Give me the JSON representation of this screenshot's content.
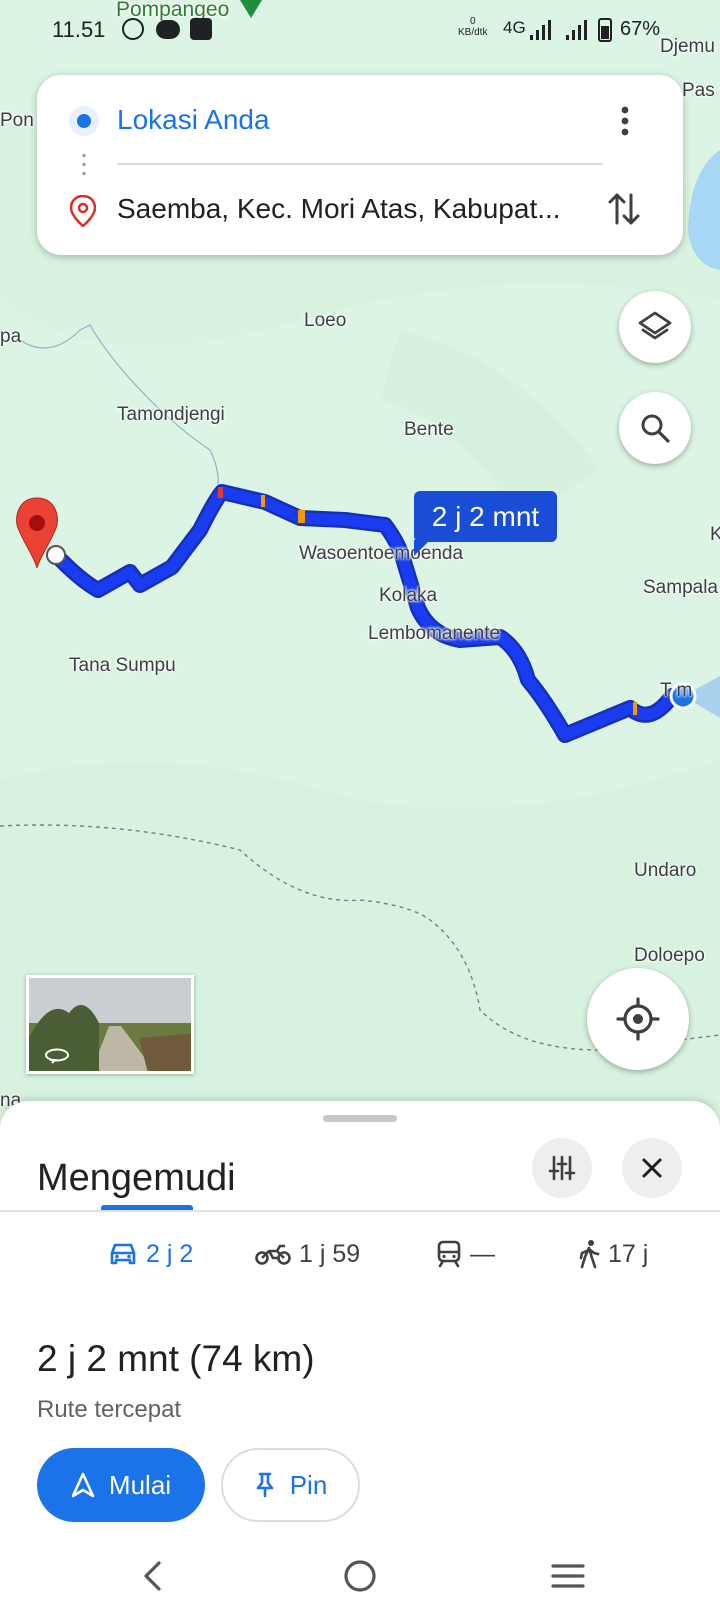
{
  "status_bar": {
    "time": "11.51",
    "notification_icons": [
      "whatsapp-icon",
      "line-icon",
      "app-icon"
    ],
    "speed_value": "0",
    "speed_unit": "KB/dtk",
    "network": "4G",
    "battery": "67%"
  },
  "search": {
    "origin": "Lokasi Anda",
    "destination": "Saemba, Kec. Mori Atas, Kabupat..."
  },
  "map": {
    "places": {
      "pompangeo": "Pompangeo",
      "djemu": "Djemu",
      "pas": "Pas",
      "pon": "Pon",
      "loeo": "Loeo",
      "pa": "pa",
      "tamondjengi": "Tamondjengi",
      "bente": "Bente",
      "k": "K",
      "wasoentoemoenda": "Wasoentoemoenda",
      "sampala": "Sampala",
      "kolaka": "Kolaka",
      "lembomanente": "Lembomanente",
      "tana_sumpu": "Tana Sumpu",
      "tomata": "T    m",
      "undaro": "Undaro",
      "doloepo": "Doloepo",
      "na": "na"
    },
    "route_callout": "2 j 2 mnt"
  },
  "sheet": {
    "title": "Mengemudi",
    "modes": [
      {
        "icon": "car-icon",
        "label": "2 j 2"
      },
      {
        "icon": "motorcycle-icon",
        "label": "1 j 59"
      },
      {
        "icon": "transit-icon",
        "label": "—"
      },
      {
        "icon": "walk-icon",
        "label": "17 j"
      }
    ],
    "summary": "2 j 2 mnt (74 km)",
    "subtitle": "Rute tercepat",
    "start_label": "Mulai",
    "pin_label": "Pin"
  },
  "colors": {
    "accent": "#1a73e8",
    "route": "#1a3cf0",
    "destination_pin": "#d93025",
    "map_bg": "#dcf4e3"
  }
}
